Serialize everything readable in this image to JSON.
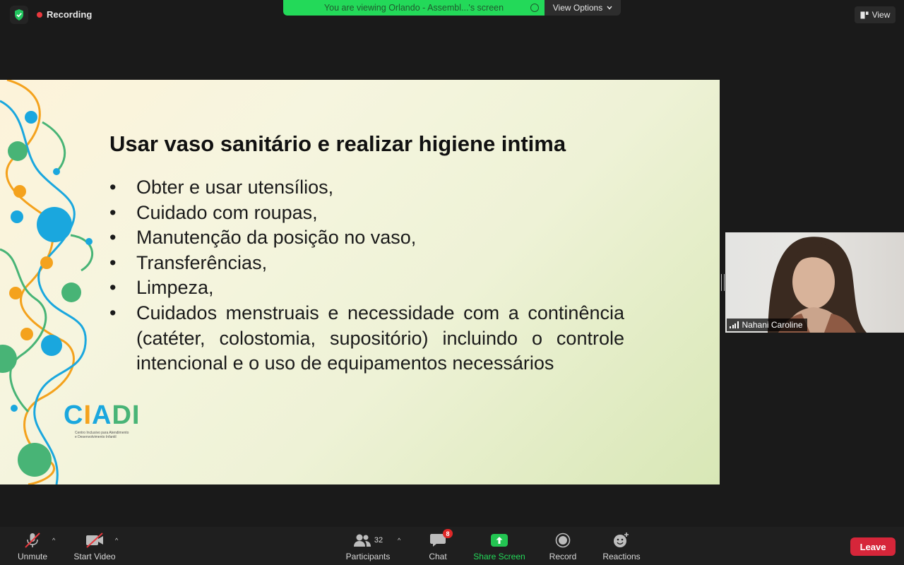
{
  "top_bar": {
    "recording_label": "Recording",
    "viewing_banner": "You are viewing Orlando - Assembl...'s screen",
    "view_options_label": "View Options",
    "view_label": "View"
  },
  "slide": {
    "title": "Usar vaso sanitário e realizar higiene intima",
    "bullets": [
      "Obter e usar utensílios,",
      "Cuidado com roupas,",
      "Manutenção da posição no vaso,",
      "Transferências,",
      "Limpeza,",
      "Cuidados menstruais e necessidade com a continência (catéter, colostomia, supositório) incluindo o controle intencional e o uso de equipamentos necessários"
    ],
    "logo_text": "CIADI",
    "logo_subtitle": "Centro Inclusivo para Atendimento e Desenvolvimento Infantil"
  },
  "participant_video": {
    "name": "Nahani Caroline"
  },
  "toolbar": {
    "unmute_label": "Unmute",
    "start_video_label": "Start Video",
    "participants_label": "Participants",
    "participants_count": "32",
    "chat_label": "Chat",
    "chat_badge": "8",
    "share_screen_label": "Share Screen",
    "record_label": "Record",
    "reactions_label": "Reactions",
    "leave_label": "Leave"
  },
  "colors": {
    "banner_green": "#23d959",
    "share_green": "#23c552",
    "leave_red": "#d6263a",
    "recording_red": "#e8383d",
    "badge_red": "#e02828"
  }
}
